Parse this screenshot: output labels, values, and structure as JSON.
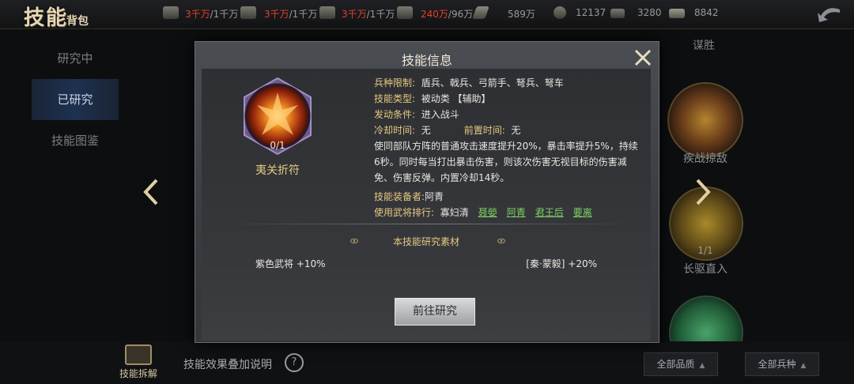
{
  "header": {
    "title_main": "技能",
    "title_sub": "背包",
    "resources": [
      {
        "icon": "grain-icon",
        "current": "3千万",
        "max": "/1千万"
      },
      {
        "icon": "wood-icon",
        "current": "3千万",
        "max": "/1千万"
      },
      {
        "icon": "stone-icon",
        "current": "3千万",
        "max": "/1千万"
      },
      {
        "icon": "iron-icon",
        "current": "240万",
        "max": "/96万"
      }
    ],
    "order_value": "589万",
    "copper": "12137",
    "jade": "3280",
    "gold": "8842"
  },
  "sidebar": {
    "items": [
      {
        "label": "研究中"
      },
      {
        "label": "已研究"
      },
      {
        "label": "技能图鉴"
      }
    ],
    "active_index": 1
  },
  "background_cards": {
    "top_right_label": "谋胜",
    "right_1_label": "疾战掠敌",
    "right_2_count": "1/1",
    "right_2_label": "长驱直入"
  },
  "bottom": {
    "research_label": "技能拆解",
    "stack_label": "技能效果叠加说明",
    "help_symbol": "?",
    "filter_quality": "全部品质",
    "filter_troop": "全部兵种"
  },
  "modal": {
    "title": "技能信息",
    "skill_name": "夷关折符",
    "skill_count": "0/1",
    "troop_limit_key": "兵种限制:",
    "troop_limit_val": "盾兵、戟兵、弓箭手、弩兵、弩车",
    "type_key": "技能类型:",
    "type_val": "被动类 【辅助】",
    "trigger_key": "发动条件:",
    "trigger_val": "进入战斗",
    "cooldown_key": "冷却时间:",
    "cooldown_val": "无",
    "precast_key": "前置时间:",
    "precast_val": "无",
    "description": "使同部队方阵的普通攻击速度提升20%，暴击率提升5%，持续6秒。同时每当打出暴击伤害，则该次伤害无视目标的伤害减免、伤害反弹。内置冷却14秒。",
    "equipped_key": "技能装备者:",
    "equipped_val": "阿青",
    "ranking_key": "使用武将排行:",
    "ranking_first": "寡妇清",
    "ranking_links": [
      "聂嫈",
      "阿青",
      "君王后",
      "要离"
    ],
    "materials_title": "本技能研究素材",
    "material_left": "紫色武将 +10%",
    "material_right": "[秦·蒙毅] +20%",
    "goto_button": "前往研究"
  },
  "colors": {
    "accent_gold": "#e7c982",
    "link_green": "#7fcf63",
    "resource_red": "#e0412f",
    "sidebar_active": "#1d3150"
  }
}
